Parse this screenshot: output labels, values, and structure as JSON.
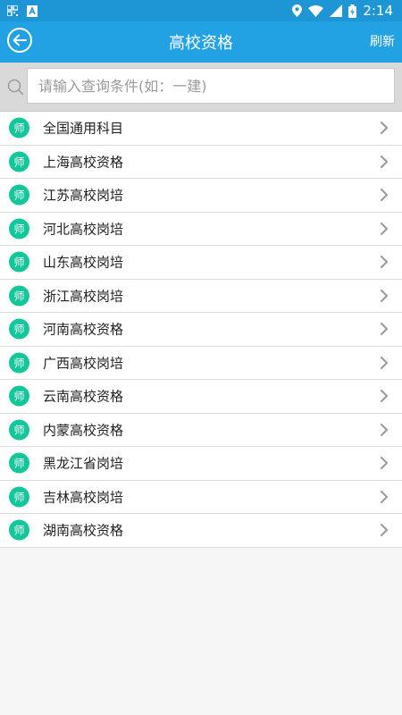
{
  "status_bar": {
    "time": "2:14",
    "icons": [
      "qr-icon",
      "sim-icon",
      "location-icon",
      "wifi-icon",
      "signal-icon",
      "battery-icon"
    ]
  },
  "app_bar": {
    "title": "高校资格",
    "refresh_label": "刷新",
    "back_icon": "back-arrow-icon"
  },
  "search": {
    "placeholder": "请输入查询条件(如：一建)",
    "value": ""
  },
  "list": {
    "badge_text": "师",
    "items": [
      {
        "label": "全国通用科目"
      },
      {
        "label": "上海高校资格"
      },
      {
        "label": "江苏高校岗培"
      },
      {
        "label": "河北高校岗培"
      },
      {
        "label": "山东高校岗培"
      },
      {
        "label": "浙江高校岗培"
      },
      {
        "label": "河南高校资格"
      },
      {
        "label": "广西高校岗培"
      },
      {
        "label": "云南高校资格"
      },
      {
        "label": "内蒙高校资格"
      },
      {
        "label": "黑龙江省岗培"
      },
      {
        "label": "吉林高校岗培"
      },
      {
        "label": "湖南高校资格"
      }
    ]
  },
  "colors": {
    "status_bar": "#1e95d4",
    "app_bar": "#23a2e3",
    "badge": "#13c79a",
    "chevron": "#9e9e9e",
    "search_area": "#d9d9d9"
  }
}
